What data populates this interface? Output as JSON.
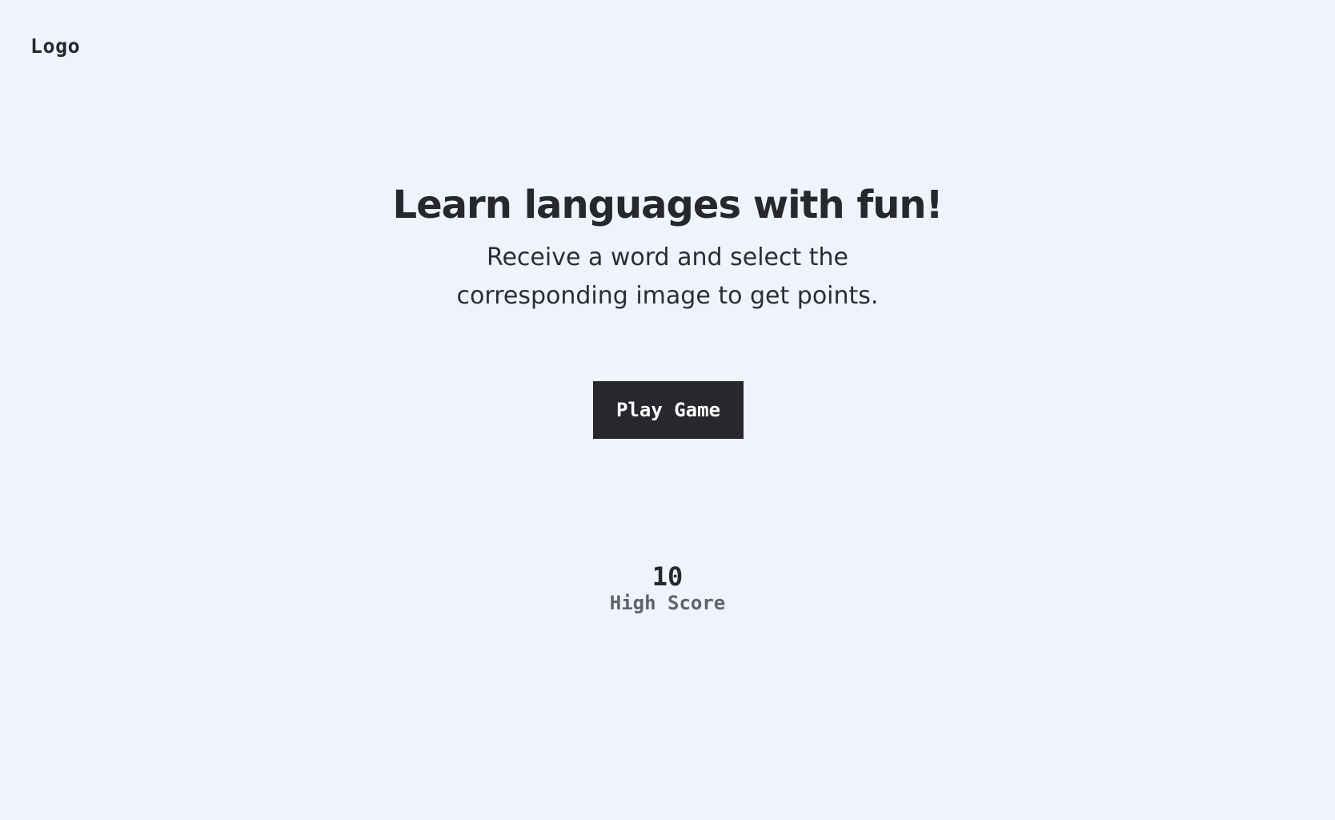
{
  "header": {
    "logo_text": "Logo"
  },
  "hero": {
    "title": "Learn languages with fun!",
    "subtitle": "Receive a word and select the corresponding image to get points."
  },
  "actions": {
    "play_label": "Play Game"
  },
  "stats": {
    "high_score_value": "10",
    "high_score_label": "High Score"
  },
  "colors": {
    "background": "#eff3fb",
    "primary": "#26282d",
    "muted": "#5d626d",
    "button_text": "#ffffff"
  }
}
